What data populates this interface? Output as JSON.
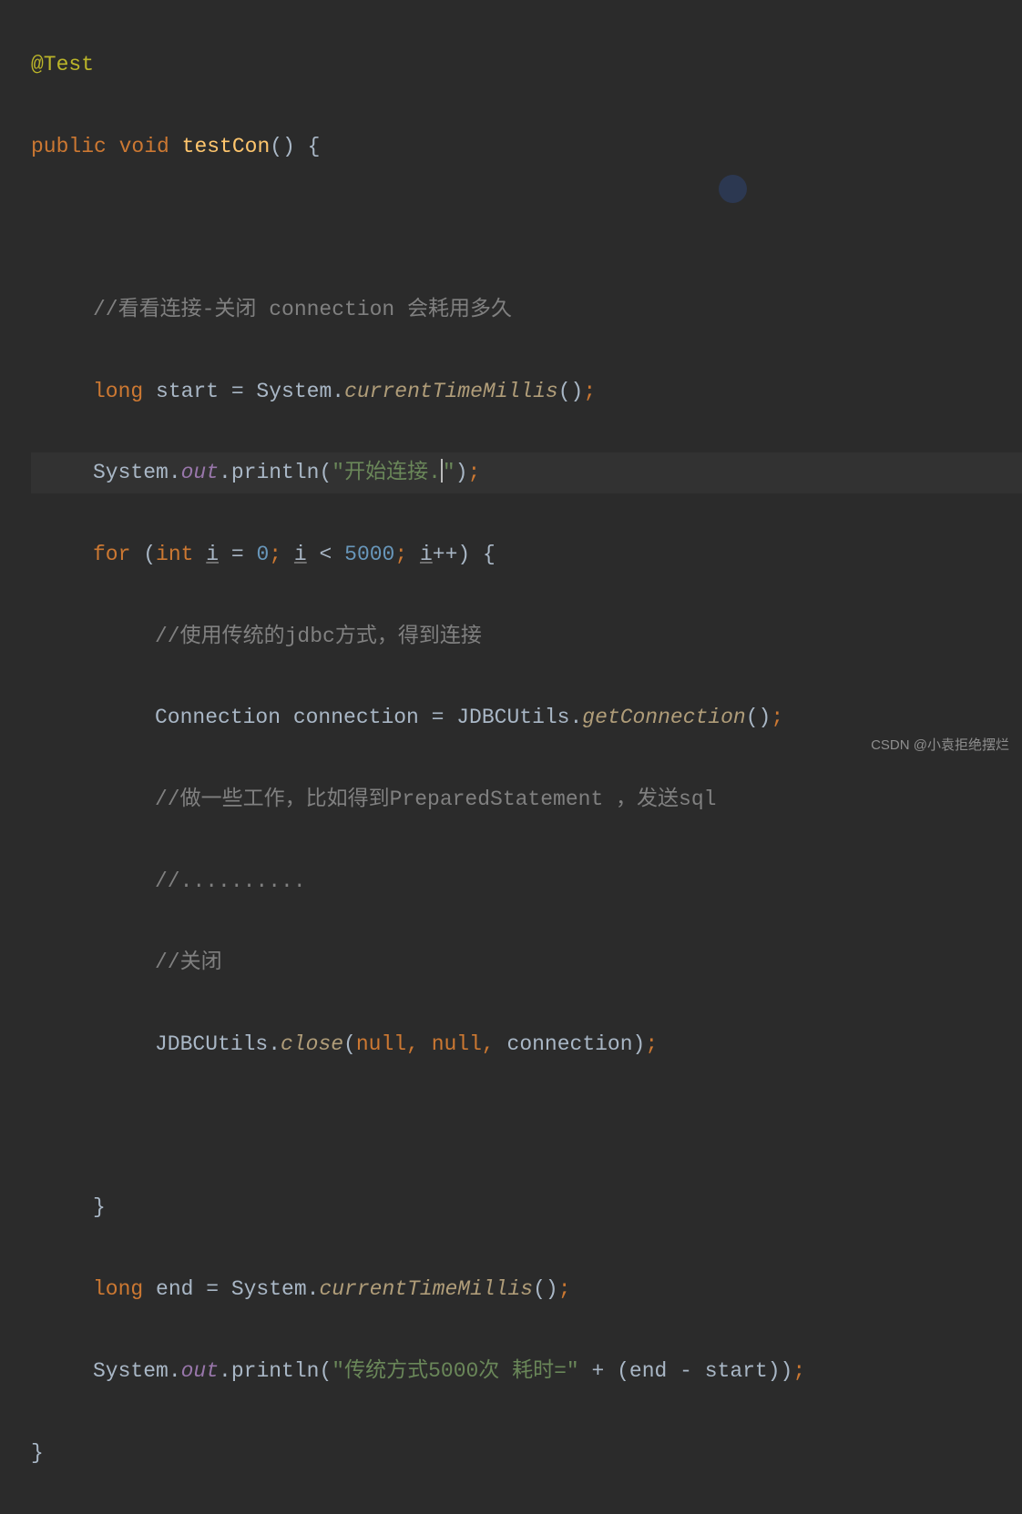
{
  "code": {
    "line1": {
      "annotation": "@Test"
    },
    "line2": {
      "kw1": "public ",
      "kw2": "void ",
      "method": "testCon",
      "paren": "() {"
    },
    "line3": "",
    "line4": {
      "comment": "//看看连接-关闭 connection 会耗用多久"
    },
    "line5": {
      "kw": "long ",
      "var": "start = System.",
      "static": "currentTimeMillis",
      "end": "()",
      "semi": ";"
    },
    "line6": {
      "p1": "System.",
      "out": "out",
      "p2": ".println(",
      "str": "\"开始连接.",
      "strEnd": "\"",
      "end": ")",
      "semi": ";"
    },
    "line7": {
      "kw1": "for ",
      "paren": "(",
      "kw2": "int ",
      "var1": "i",
      "eq": " = ",
      "num1": "0",
      "sep1": "; ",
      "var2": "i",
      "op": " < ",
      "num2": "5000",
      "sep2": "; ",
      "var3": "i",
      "inc": "++) {"
    },
    "line8": {
      "comment": "//使用传统的jdbc方式，得到连接"
    },
    "line9": {
      "p1": "Connection connection = JDBCUtils.",
      "method": "getConnection",
      "end": "()",
      "semi": ";"
    },
    "line10": {
      "comment": "//做一些工作，比如得到PreparedStatement ，发送sql"
    },
    "line11": {
      "comment": "//.........."
    },
    "line12": {
      "comment": "//关闭"
    },
    "line13": {
      "p1": "JDBCUtils.",
      "method": "close",
      "paren": "(",
      "kw1": "null",
      "sep1": ", ",
      "kw2": "null",
      "sep2": ", ",
      "var": "connection)",
      "semi": ";"
    },
    "line14": "",
    "line15": {
      "brace": "}"
    },
    "line16": {
      "kw": "long ",
      "var": "end = System.",
      "static": "currentTimeMillis",
      "end": "()",
      "semi": ";"
    },
    "line17": {
      "p1": "System.",
      "out": "out",
      "p2": ".println(",
      "str": "\"传统方式5000次 耗时=\"",
      "plus": " + (end - start))",
      "semi": ";"
    },
    "line18": {
      "brace": "}"
    }
  },
  "watermark": "CSDN @小袁拒绝摆烂"
}
